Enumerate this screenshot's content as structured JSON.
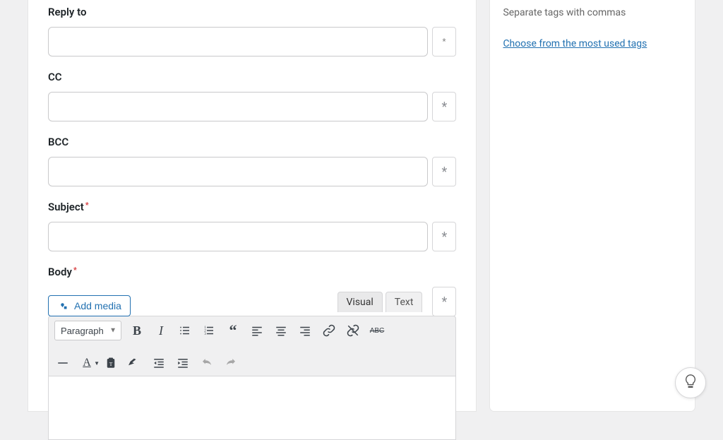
{
  "fields": {
    "reply_to": {
      "label": "Reply to",
      "value": ""
    },
    "cc": {
      "label": "CC",
      "value": ""
    },
    "bcc": {
      "label": "BCC",
      "value": ""
    },
    "subject": {
      "label": "Subject",
      "required_mark": "*",
      "value": ""
    },
    "body": {
      "label": "Body",
      "required_mark": "*"
    }
  },
  "editor": {
    "add_media_label": "Add media",
    "tabs": {
      "visual": "Visual",
      "text": "Text"
    },
    "format_select": "Paragraph",
    "strike_label": "ABC"
  },
  "sidebar": {
    "tags_hint": "Separate tags with commas",
    "tags_link": "Choose from the most used tags"
  }
}
